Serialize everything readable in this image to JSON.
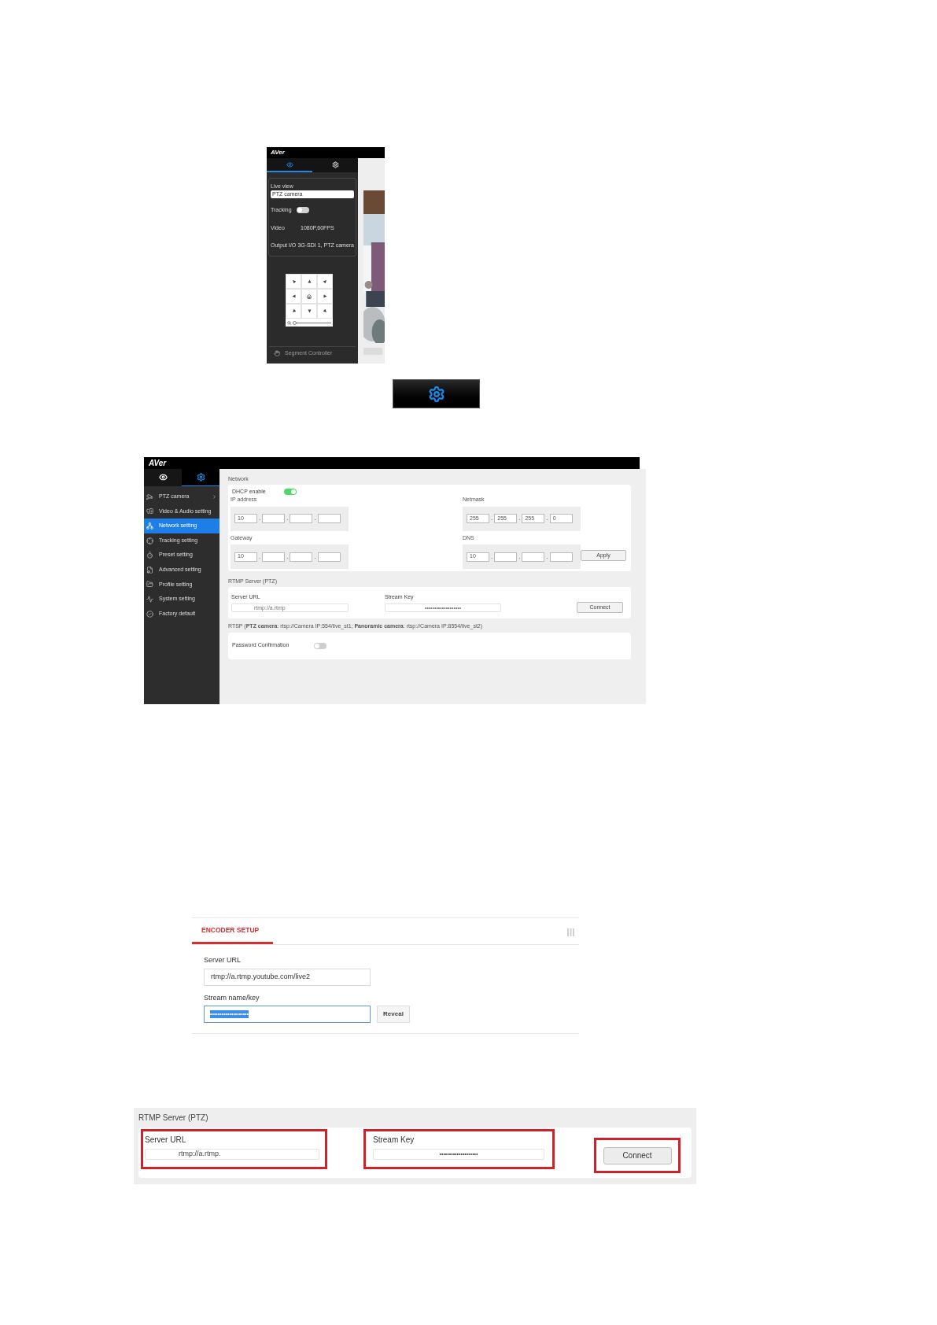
{
  "live_view_screenshot": {
    "logo": "AVer",
    "tabs": [
      {
        "kind": "view",
        "selected": true
      },
      {
        "kind": "settings",
        "selected": false
      }
    ],
    "live_view_label": "Live view",
    "source": "PTZ camera",
    "tracking": {
      "label": "Tracking",
      "on": false
    },
    "info": [
      {
        "label": "Video",
        "value": "1080P,60FPS"
      },
      {
        "label": "Output I/O",
        "value": "3G-SDI 1, PTZ camera"
      }
    ],
    "zoom": {
      "level": 0.05
    },
    "segment_controller": "Segment Controller"
  },
  "settings_screenshot": {
    "logo": "AVer",
    "tabs": [
      {
        "kind": "view",
        "selected": false
      },
      {
        "kind": "settings",
        "selected": true
      }
    ],
    "sidebar": {
      "items": [
        {
          "label": "PTZ camera",
          "selected": false,
          "submenu": true
        },
        {
          "label": "Video & Audio setting",
          "selected": false,
          "submenu": false
        },
        {
          "label": "Network setting",
          "selected": true,
          "submenu": false
        },
        {
          "label": "Tracking setting",
          "selected": false,
          "submenu": false
        },
        {
          "label": "Preset setting",
          "selected": false,
          "submenu": false
        },
        {
          "label": "Advanced setting",
          "selected": false,
          "submenu": false
        },
        {
          "label": "Profile setting",
          "selected": false,
          "submenu": false
        },
        {
          "label": "System setting",
          "selected": false,
          "submenu": false
        },
        {
          "label": "Factory default",
          "selected": false,
          "submenu": false
        }
      ]
    },
    "network": {
      "title": "Network",
      "dhcp": {
        "label": "DHCP enable",
        "on": true
      },
      "fields": [
        {
          "label": "IP address",
          "separator": ".",
          "octets": [
            "10"
          ]
        },
        {
          "label": "Netmask",
          "separator": ".",
          "octets": [
            "255",
            "255",
            "255",
            "0"
          ]
        },
        {
          "label": "Gateway",
          "separator": ".",
          "octets": [
            "10"
          ]
        },
        {
          "label": "DNS",
          "separator": ".",
          "octets": [
            "10"
          ]
        }
      ],
      "apply": "Apply"
    },
    "rtmp": {
      "title": "RTMP Server (PTZ)",
      "server_url_label": "Server URL",
      "server_url": "rtmp://a.rtmp",
      "stream_key_label": "Stream Key",
      "stream_key": "•••••••••••••••••••",
      "connect": "Connect"
    },
    "rtsp": {
      "title": "RTSP (**PTZ camera**: rtsp://Camera IP:554/live_st1; **Panoramic camera**: rtsp://Camera IP:8554/live_st2)",
      "password_label": "Password Confirmation",
      "on": false
    }
  },
  "encoder_setup": {
    "tab": "ENCODER SETUP",
    "server_url_label": "Server URL",
    "server_url": "rtmp://a.rtmp.youtube.com/live2",
    "stream_key_label": "Stream name/key",
    "stream_key": "••••••••••••••••••••",
    "key_selected": true,
    "reveal": "Reveal"
  },
  "rtmp_closeup": {
    "title": "RTMP Server (PTZ)",
    "server_url": {
      "label": "Server URL",
      "value": "rtmp://a.rtmp.",
      "highlighted": true
    },
    "stream_key": {
      "label": "Stream Key",
      "value": "••••••••••••••••••••",
      "highlighted": true
    },
    "connect": {
      "label": "Connect",
      "highlighted": true
    }
  }
}
